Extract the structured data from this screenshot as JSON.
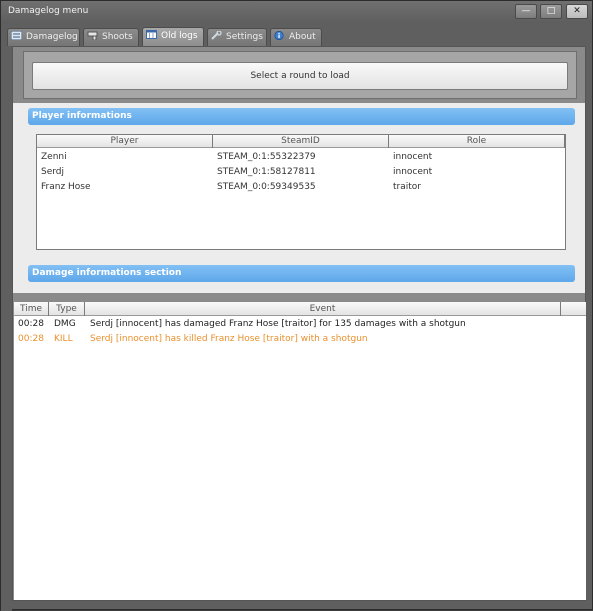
{
  "window": {
    "title": "Damagelog menu",
    "min_icon": "minimize-icon",
    "max_icon": "maximize-icon",
    "close_icon": "close-icon"
  },
  "tabs": [
    {
      "label": "Damagelog",
      "icon": "list-icon",
      "active": false
    },
    {
      "label": "Shoots",
      "icon": "gun-icon",
      "active": false
    },
    {
      "label": "Old logs",
      "icon": "calendar-icon",
      "active": true
    },
    {
      "label": "Settings",
      "icon": "wrench-icon",
      "active": false
    },
    {
      "label": "About",
      "icon": "info-icon",
      "active": false
    }
  ],
  "load_button": "Select a round to load",
  "player_section": {
    "title": "Player informations",
    "columns": [
      "Player",
      "SteamID",
      "Role"
    ],
    "rows": [
      {
        "player": "Zenni",
        "steamid": "STEAM_0:1:55322379",
        "role": "innocent"
      },
      {
        "player": "Serdj",
        "steamid": "STEAM_0:1:58127811",
        "role": "innocent"
      },
      {
        "player": "Franz Hose",
        "steamid": "STEAM_0:0:59349535",
        "role": "traitor"
      }
    ]
  },
  "damage_section": {
    "title": "Damage informations section",
    "columns": [
      "Time",
      "Type",
      "Event"
    ],
    "rows": [
      {
        "time": "00:28",
        "type": "DMG",
        "event": "Serdj [innocent] has damaged Franz Hose [traitor] for 135 damages with a shotgun",
        "color": "#222222"
      },
      {
        "time": "00:28",
        "type": "KILL",
        "event": "Serdj [innocent] has killed Franz Hose [traitor] with a shotgun",
        "color": "#e8902c"
      }
    ]
  },
  "colors": {
    "accent": "#6cb3f0",
    "kill": "#e8902c"
  }
}
